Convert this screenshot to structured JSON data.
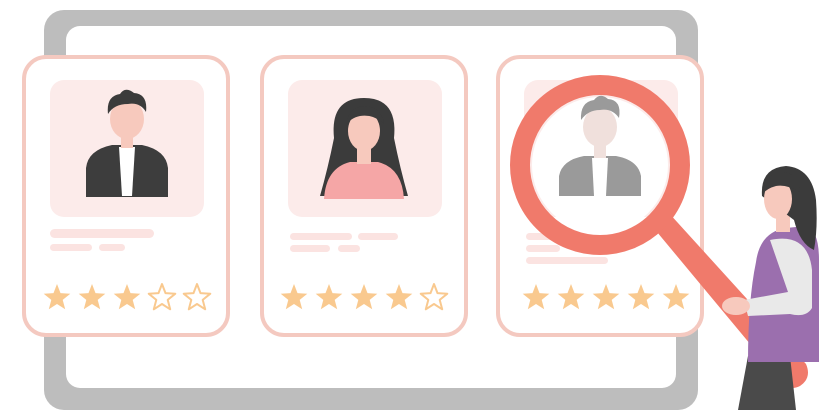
{
  "illustration": {
    "subject": "candidate-review",
    "colors": {
      "monitor_frame": "#bdbdbd",
      "monitor_screen": "#ffffff",
      "card_border": "#f4c9c0",
      "card_photo_bg": "#fcebea",
      "card_line": "#fbe3e1",
      "star_fill": "#f9c98f",
      "star_outline": "#f9c98f",
      "skin": "#f7c9bd",
      "hair_dark": "#3b3b3b",
      "suit_dark": "#3d3d3d",
      "shirt_white": "#ffffff",
      "dress_pink": "#f5a6a6",
      "magnifier_red": "#f07a6b",
      "person_purple": "#9b6fae",
      "person_pants": "#4a4a4a",
      "person_sleeve": "#e9e9e9"
    }
  },
  "cards": [
    {
      "id": "candidate-1",
      "avatar": "man-in-suit-icon",
      "rating": 3,
      "max_rating": 5
    },
    {
      "id": "candidate-2",
      "avatar": "woman-long-hair-icon",
      "rating": 4,
      "max_rating": 5
    },
    {
      "id": "candidate-3",
      "avatar": "man-in-suit-icon",
      "rating": 5,
      "max_rating": 5,
      "highlighted": true
    }
  ]
}
